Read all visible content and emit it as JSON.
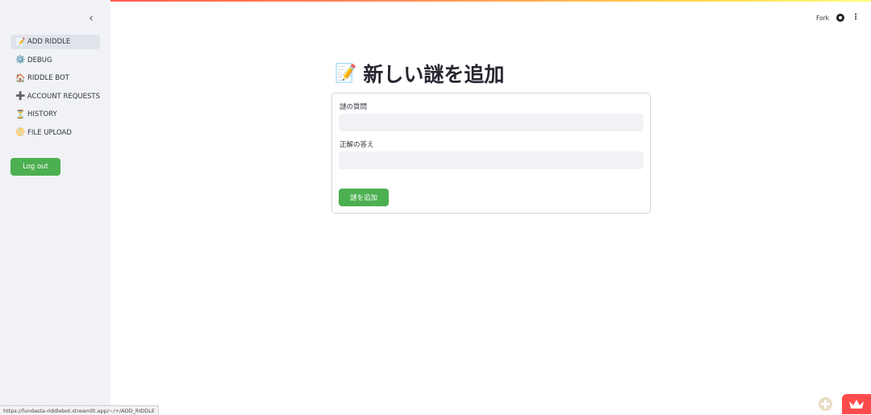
{
  "sidebar": {
    "collapse_icon": "‹",
    "items": [
      {
        "icon": "📝",
        "icon_name": "memo-icon",
        "label": "ADD RIDDLE",
        "active": true
      },
      {
        "icon": "⚙️",
        "icon_name": "gear-icon",
        "label": "DEBUG"
      },
      {
        "icon": "🏠",
        "icon_name": "house-icon",
        "label": "RIDDLE BOT"
      },
      {
        "icon": "➕",
        "icon_name": "plus-icon",
        "label": "ACCOUNT REQUESTS"
      },
      {
        "icon": "⏳",
        "icon_name": "hourglass-icon",
        "label": "HISTORY"
      },
      {
        "icon": "📀",
        "icon_name": "disc-icon",
        "label": "FILE UPLOAD"
      }
    ],
    "logout_label": "Log out"
  },
  "header": {
    "fork_label": "Fork",
    "menu_icon": "⋮"
  },
  "main": {
    "title_icon": "📝",
    "title": "新しい謎を追加",
    "form": {
      "question_label": "謎の質問",
      "question_value": "",
      "answer_label": "正解の答え",
      "answer_value": "",
      "submit_label": "謎を追加"
    }
  },
  "status_bar": {
    "url": "https://fundasta-riddlebot.streamlit.app/~/+/ADD_RIDDLE"
  },
  "colors": {
    "accent_green": "#4caf50",
    "sidebar_bg": "#f0f2f6",
    "streamlit_red": "#ff4b4b"
  }
}
